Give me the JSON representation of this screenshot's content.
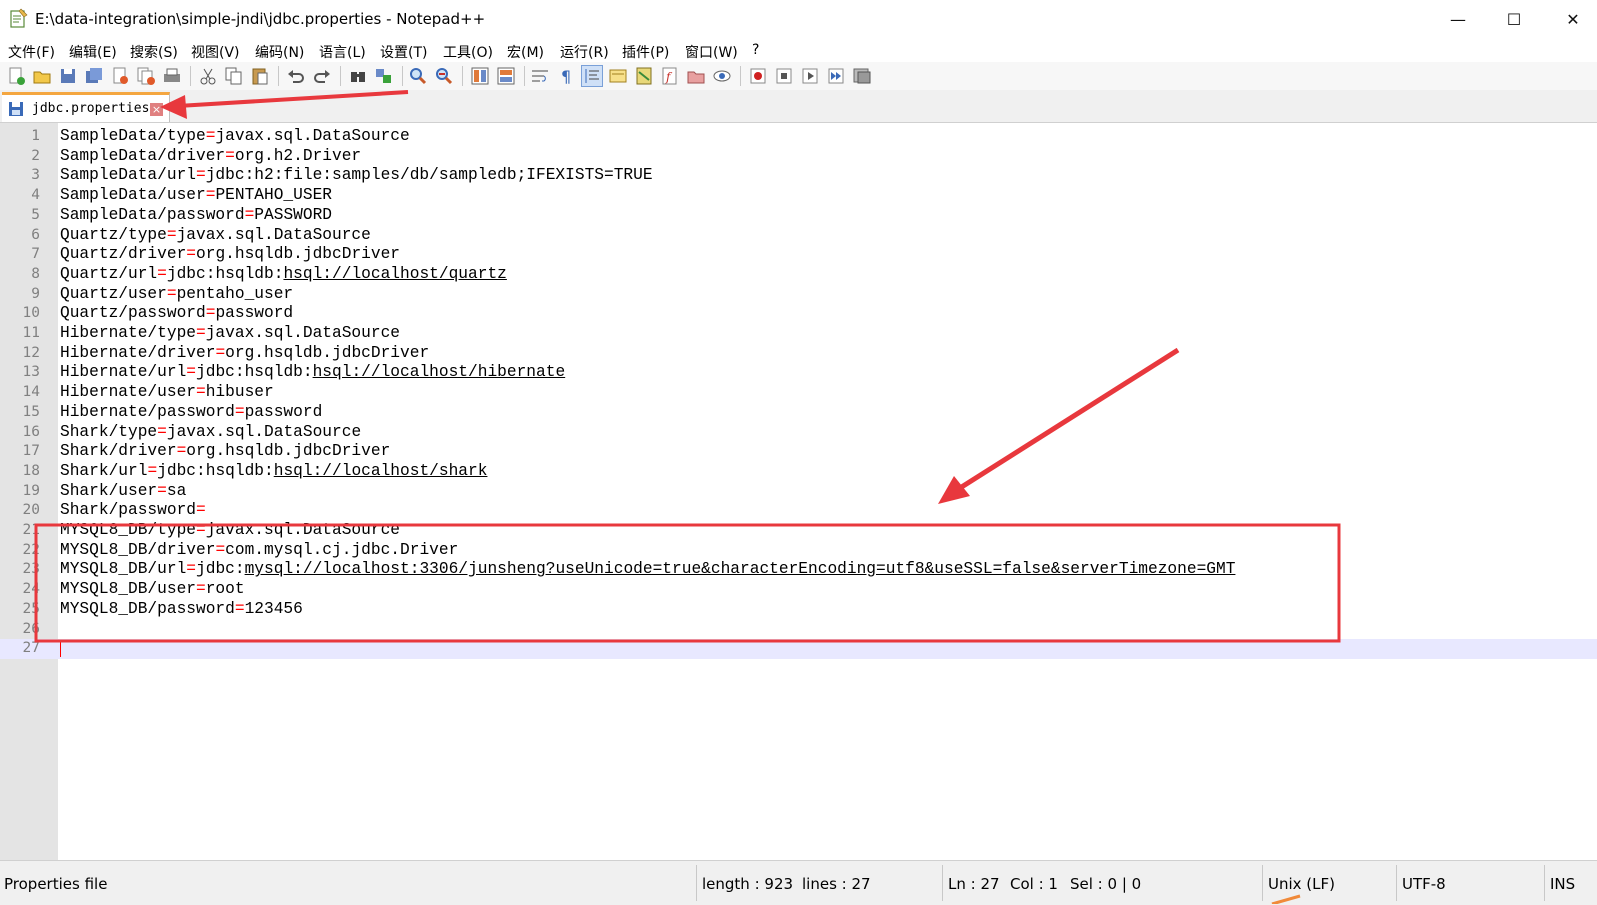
{
  "window": {
    "title": "E:\\data-integration\\simple-jndi\\jdbc.properties - Notepad++",
    "minimize": "—",
    "maximize": "☐",
    "close": "✕"
  },
  "menu": [
    "文件(F)",
    "编辑(E)",
    "搜索(S)",
    "视图(V)",
    "编码(N)",
    "语言(L)",
    "设置(T)",
    "工具(O)",
    "宏(M)",
    "运行(R)",
    "插件(P)",
    "窗口(W)",
    "?"
  ],
  "tab": {
    "label": "jdbc.properties",
    "close": "×"
  },
  "lines": [
    {
      "n": "1",
      "key": "SampleData/type",
      "val": "javax.sql.DataSource"
    },
    {
      "n": "2",
      "key": "SampleData/driver",
      "val": "org.h2.Driver"
    },
    {
      "n": "3",
      "key": "SampleData/url",
      "val": "jdbc:h2:file:samples/db/sampledb;IFEXISTS=TRUE"
    },
    {
      "n": "4",
      "key": "SampleData/user",
      "val": "PENTAHO_USER"
    },
    {
      "n": "5",
      "key": "SampleData/password",
      "val": "PASSWORD"
    },
    {
      "n": "6",
      "key": "Quartz/type",
      "val": "javax.sql.DataSource"
    },
    {
      "n": "7",
      "key": "Quartz/driver",
      "val": "org.hsqldb.jdbcDriver"
    },
    {
      "n": "8",
      "key": "Quartz/url",
      "val": "jdbc:hsqldb:",
      "link": "hsql://localhost/quartz"
    },
    {
      "n": "9",
      "key": "Quartz/user",
      "val": "pentaho_user"
    },
    {
      "n": "10",
      "key": "Quartz/password",
      "val": "password"
    },
    {
      "n": "11",
      "key": "Hibernate/type",
      "val": "javax.sql.DataSource"
    },
    {
      "n": "12",
      "key": "Hibernate/driver",
      "val": "org.hsqldb.jdbcDriver"
    },
    {
      "n": "13",
      "key": "Hibernate/url",
      "val": "jdbc:hsqldb:",
      "link": "hsql://localhost/hibernate"
    },
    {
      "n": "14",
      "key": "Hibernate/user",
      "val": "hibuser"
    },
    {
      "n": "15",
      "key": "Hibernate/password",
      "val": "password"
    },
    {
      "n": "16",
      "key": "Shark/type",
      "val": "javax.sql.DataSource"
    },
    {
      "n": "17",
      "key": "Shark/driver",
      "val": "org.hsqldb.jdbcDriver"
    },
    {
      "n": "18",
      "key": "Shark/url",
      "val": "jdbc:hsqldb:",
      "link": "hsql://localhost/shark"
    },
    {
      "n": "19",
      "key": "Shark/user",
      "val": "sa"
    },
    {
      "n": "20",
      "key": "Shark/password",
      "val": ""
    },
    {
      "n": "21",
      "key": "MYSQL8_DB/type",
      "val": "javax.sql.DataSource"
    },
    {
      "n": "22",
      "key": "MYSQL8_DB/driver",
      "val": "com.mysql.cj.jdbc.Driver"
    },
    {
      "n": "23",
      "key": "MYSQL8_DB/url",
      "val": "jdbc:",
      "link": "mysql://localhost:3306/junsheng?useUnicode=true&characterEncoding=utf8&useSSL=false&serverTimezone=GMT"
    },
    {
      "n": "24",
      "key": "MYSQL8_DB/user",
      "val": "root"
    },
    {
      "n": "25",
      "key": "MYSQL8_DB/password",
      "val": "123456"
    },
    {
      "n": "26",
      "key": "",
      "val": ""
    },
    {
      "n": "27",
      "key": "",
      "val": ""
    }
  ],
  "status": {
    "filetype": "Properties file",
    "length": "length : 923",
    "lines": "lines : 27",
    "ln": "Ln : 27",
    "col": "Col : 1",
    "sel": "Sel : 0 | 0",
    "eol": "Unix (LF)",
    "encoding": "UTF-8",
    "mode": "INS"
  },
  "colors": {
    "annotation": "#e8383d",
    "tab_accent": "#f4a640",
    "operator": "#ff0000",
    "line_number": "#808080"
  },
  "icons": [
    "new-file-icon",
    "open-icon",
    "save-icon",
    "save-all-icon",
    "close-icon",
    "close-all-icon",
    "print-icon",
    "cut-icon",
    "copy-icon",
    "paste-icon",
    "undo-icon",
    "redo-icon",
    "find-icon",
    "replace-icon",
    "zoom-in-icon",
    "zoom-out-icon",
    "sync-v-icon",
    "sync-h-icon",
    "word-wrap-icon",
    "show-all-chars-icon",
    "indent-guide-icon",
    "user-lang-icon",
    "doc-map-icon",
    "function-list-icon",
    "folder-workspace-icon",
    "monitor-icon",
    "record-macro-icon",
    "stop-macro-icon",
    "play-macro-icon",
    "run-macro-multiple-icon",
    "save-macro-icon"
  ]
}
